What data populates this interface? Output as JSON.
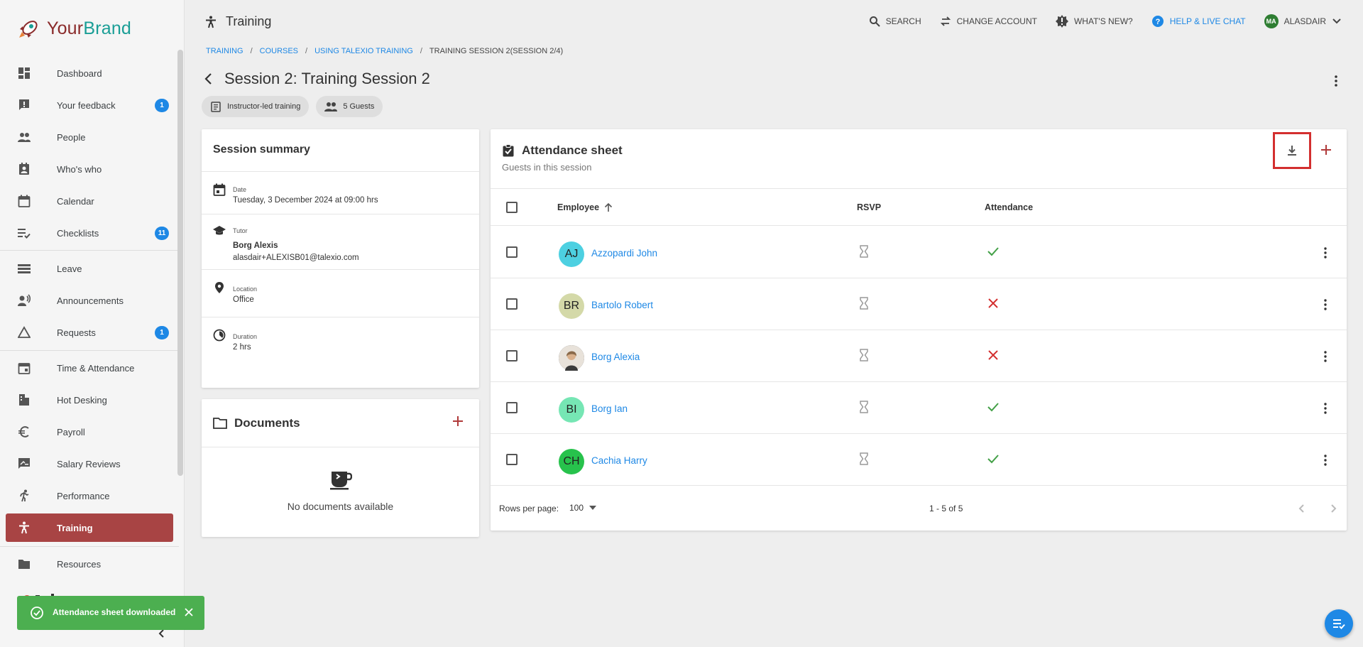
{
  "brand": {
    "part1": "Your",
    "part2": "Brand"
  },
  "sidebar": {
    "items": [
      {
        "label": "Dashboard",
        "icon": "dashboard-icon",
        "badge": ""
      },
      {
        "label": "Your feedback",
        "icon": "feedback-icon",
        "badge": "1"
      },
      {
        "label": "People",
        "icon": "people-icon",
        "badge": ""
      },
      {
        "label": "Who's who",
        "icon": "contact-icon",
        "badge": ""
      },
      {
        "label": "Calendar",
        "icon": "calendar-icon",
        "badge": ""
      },
      {
        "label": "Checklists",
        "icon": "checklist-icon",
        "badge": "11"
      },
      {
        "label": "Leave",
        "icon": "leave-icon",
        "badge": ""
      },
      {
        "label": "Announcements",
        "icon": "announcement-icon",
        "badge": ""
      },
      {
        "label": "Requests",
        "icon": "warning-icon",
        "badge": "1"
      },
      {
        "label": "Time & Attendance",
        "icon": "event-icon",
        "badge": ""
      },
      {
        "label": "Hot Desking",
        "icon": "desk-icon",
        "badge": ""
      },
      {
        "label": "Payroll",
        "icon": "euro-icon",
        "badge": ""
      },
      {
        "label": "Salary Reviews",
        "icon": "rate-review-icon",
        "badge": ""
      },
      {
        "label": "Performance",
        "icon": "run-icon",
        "badge": ""
      },
      {
        "label": "Training",
        "icon": "accessibility-icon",
        "badge": ""
      },
      {
        "label": "Resources",
        "icon": "folder-icon",
        "badge": ""
      }
    ]
  },
  "topbar": {
    "title": "Training",
    "search": "SEARCH",
    "change_account": "CHANGE ACCOUNT",
    "whats_new": "WHAT'S NEW?",
    "help": "HELP & LIVE CHAT",
    "user_initials": "MA",
    "user_name": "ALASDAIR"
  },
  "breadcrumb": {
    "items": [
      "TRAINING",
      "COURSES",
      "USING TALEXIO TRAINING"
    ],
    "current": "TRAINING SESSION 2(SESSION 2/4)"
  },
  "page": {
    "title": "Session 2: Training Session 2",
    "chip_type": "Instructor-led training",
    "chip_guests": "5 Guests"
  },
  "summary": {
    "title": "Session summary",
    "date_label": "Date",
    "date_value": "Tuesday, 3 December 2024 at 09:00 hrs",
    "tutor_label": "Tutor",
    "tutor_name": "Borg Alexis",
    "tutor_email": "alasdair+ALEXISB01@talexio.com",
    "location_label": "Location",
    "location_value": "Office",
    "duration_label": "Duration",
    "duration_value": "2 hrs"
  },
  "documents": {
    "title": "Documents",
    "empty": "No documents available"
  },
  "attendance": {
    "title": "Attendance sheet",
    "subtitle": "Guests in this session",
    "col_employee": "Employee",
    "col_rsvp": "RSVP",
    "col_attendance": "Attendance",
    "rows": [
      {
        "initials": "AJ",
        "name": "Azzopardi John",
        "attended": true,
        "avatar_color": "#4dd0e1"
      },
      {
        "initials": "BR",
        "name": "Bartolo Robert",
        "attended": false,
        "avatar_color": "#d4d9a8"
      },
      {
        "initials": "",
        "name": "Borg Alexia",
        "attended": false,
        "avatar_color": "#3a3a3a"
      },
      {
        "initials": "BI",
        "name": "Borg Ian",
        "attended": true,
        "avatar_color": "#76e6b4"
      },
      {
        "initials": "CH",
        "name": "Cachia Harry",
        "attended": true,
        "avatar_color": "#27c24c"
      }
    ],
    "rows_per_page_label": "Rows per page:",
    "rows_per_page_value": "100",
    "range": "1 - 5 of 5"
  },
  "toast": {
    "message": "Attendance sheet downloaded"
  },
  "colors": {
    "accent": "#a84444",
    "link": "#1e88e5",
    "success": "#4caf50",
    "error": "#d32f2f"
  }
}
